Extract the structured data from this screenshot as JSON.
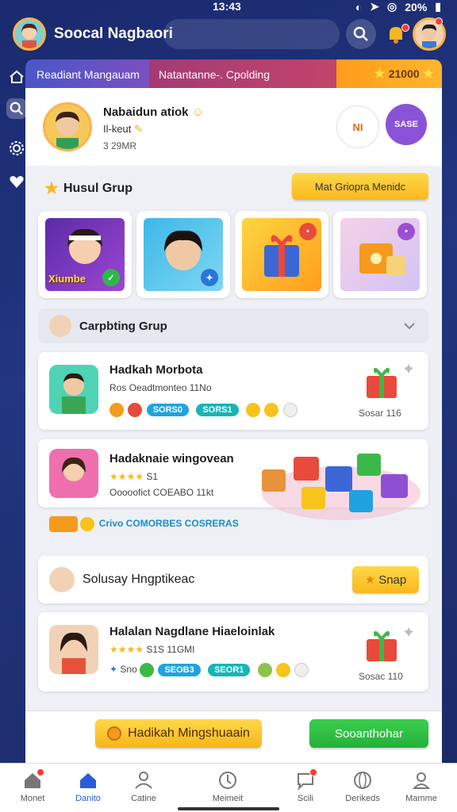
{
  "status_bar": {
    "time": "13:43",
    "battery": "20%"
  },
  "header": {
    "title": "Soocal Nagbaori"
  },
  "tabs": [
    {
      "label": "Readiant Mangauam"
    },
    {
      "label": "Natantanne-. Cpolding"
    },
    {
      "label": "21000"
    }
  ],
  "profile": {
    "name": "Nabaidun atiok",
    "subtitle": "Il-keut",
    "stat": "3 29MR",
    "badge_one": "NI",
    "badge_two": "SASE"
  },
  "section_group": {
    "title": "Husul Grup",
    "button": "Mat  Griopra Menidc"
  },
  "tiles": [
    {
      "label": "Xiumbe"
    },
    {
      "label": ""
    },
    {
      "label": ""
    },
    {
      "label": ""
    }
  ],
  "collapsible": {
    "label": "Carpbting Grup"
  },
  "cards": [
    {
      "title": "Hadkah Morbota",
      "meta": "Ros  Oeadtmonteo  11No",
      "pill_one": "SORS0",
      "pill_two": "SORS1",
      "right_text": "Sosar  116"
    },
    {
      "title": "Hadaknaie wingovean",
      "meta": "S1",
      "meta_two": "Ooooofict COEABO  11kt",
      "tags": "Crivo  COMORBES  COSRERAS"
    },
    {
      "title": "Halalan Nagdlane Hiaeloinlak",
      "meta": "S1S  11GMI",
      "pill_one": "SEOB3",
      "pill_two": "SEOR1",
      "extra": "Sno",
      "right_text": "Sosac  110"
    }
  ],
  "section_two": {
    "label": "Solusay Hngptikeac",
    "button": "Snap"
  },
  "footer": {
    "primary_button": "Hadikah Mingshuaain",
    "secondary_button": "Sooanthohar"
  },
  "bottom_nav": [
    {
      "label": "Monet"
    },
    {
      "label": "Danito"
    },
    {
      "label": "Catine"
    },
    {
      "label": "Meimeit"
    },
    {
      "label": "Scili"
    },
    {
      "label": "Derikeds"
    },
    {
      "label": "Mamme"
    }
  ],
  "colors": {
    "background": "#1f3078",
    "accent_orange": "#ffb52d",
    "accent_green": "#24b03a",
    "accent_blue": "#1fa3e0"
  }
}
